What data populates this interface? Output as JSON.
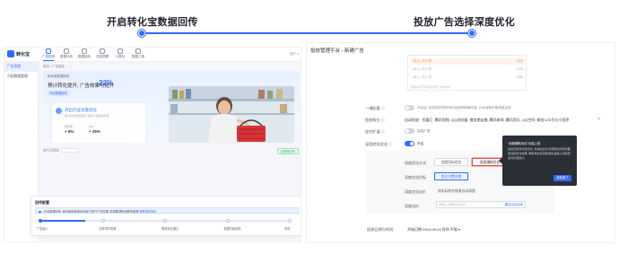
{
  "steps": {
    "step1_title": "开启转化宝数据回传",
    "step2_title": "投放广告选择深度优化"
  },
  "left_panel": {
    "logo_text": "转化宝",
    "nav": [
      {
        "label": "广告投放",
        "active": true
      },
      {
        "label": "数据分析",
        "active": false
      },
      {
        "label": "数据回传",
        "active": false
      },
      {
        "label": "归因洞察",
        "active": false
      },
      {
        "label": "人群包",
        "active": false
      },
      {
        "label": "配置工具",
        "active": false
      }
    ],
    "top_right": "账户 ▾",
    "sidebar": [
      {
        "label": "广告投放",
        "active": true
      },
      {
        "label": "归因数据管理",
        "active": false
      }
    ],
    "breadcrumb": "首页 / 广告投放",
    "banner": {
      "small_text": "转化宝数据回传",
      "headline": "预计转化提升, 广告效果可提升",
      "percent": "22%",
      "tag": "开启数据回传"
    },
    "card": {
      "title": "开启行业深度优化",
      "subtitle": "结合转化数据回传, 提高广告投放效果",
      "metric1_label": "转化率",
      "metric1_value": "+ 8%",
      "metric2_label": "ROI",
      "metric2_value": "+ 25%"
    },
    "filter_label": "按行业筛选",
    "filter_button": "去配置回传",
    "setup": {
      "title": "回传配置",
      "alert_text": "开启数据回传, 即可使用深度优化能力提升广告效果, 若需要帮助请联系客服",
      "alert_link": "查看操作指引",
      "progress_fraction": 0.18,
      "nodes": [
        "广告接入",
        "回传事件配置",
        "联调测试通过",
        "数据开始回传",
        "完成"
      ]
    }
  },
  "right_panel": {
    "title": "投放管理平台 - 新建广告",
    "top_rows": [
      {
        "label": "18.4 - 30.2 岁",
        "pct": "30%",
        "highlight": true
      },
      {
        "label": "18.4 - 30.2 岁",
        "pct": "17%",
        "highlight": false
      },
      {
        "label": "18.4 - 30.2 岁",
        "pct": "13%",
        "highlight": false
      }
    ],
    "top_note": "数据来源于转化宝回传, 仅供参考",
    "fields": [
      {
        "label": "一键起量 ⓘ",
        "type": "toggle",
        "on": false,
        "text": "开启后, 系统将在短时间内加速获取曝光量, 计划消耗可能明显加快"
      },
      {
        "label": "投放版位 ⓘ",
        "type": "text",
        "text": "自动投放 · 优量汇, 腾讯视频, QQ浏览器, 微信朋友圈, 腾讯新闻, 腾讯音乐, QQ空间, 微信公众号与小程序"
      },
      {
        "label": "定向扩展 ⓘ",
        "type": "toggle",
        "on": false,
        "text": "智能扩展"
      },
      {
        "label": "深度转化优化 ⓘ",
        "type": "toggle",
        "on": true,
        "text": "开启"
      }
    ],
    "sub": {
      "row1_label": "深度优化方式",
      "opt_a": "深度目标优化",
      "opt_b": "深度辅助优化",
      "row2_label": "深度优化目标",
      "opt_c": "首次付费次数",
      "row3_label": "深度优化出价",
      "row3_text": "按实际转化效果自动调整",
      "row4_label": "深度出价",
      "input_placeholder": "请输入深度转化出价",
      "input_suggest": "建议出价区间"
    },
    "tooltip": {
      "title": "\"深度辅助优化\"功能上线",
      "body": "投放深度转化目标时, 系统在优化浅层转化的同时兼顾深度转化效果, 帮助你在稳定起量的基础上获取更多高价值用户。",
      "button": "我知道了"
    },
    "schedule_label": "投放日期与时间",
    "schedule_text": "开始日期 2024-08-24 时间 不限 ▾"
  },
  "colors": {
    "accent": "#2f6bff",
    "highlight_red": "#e04a3f",
    "tooltip_bg": "#2b2f36",
    "success_green": "#2fb36b"
  }
}
